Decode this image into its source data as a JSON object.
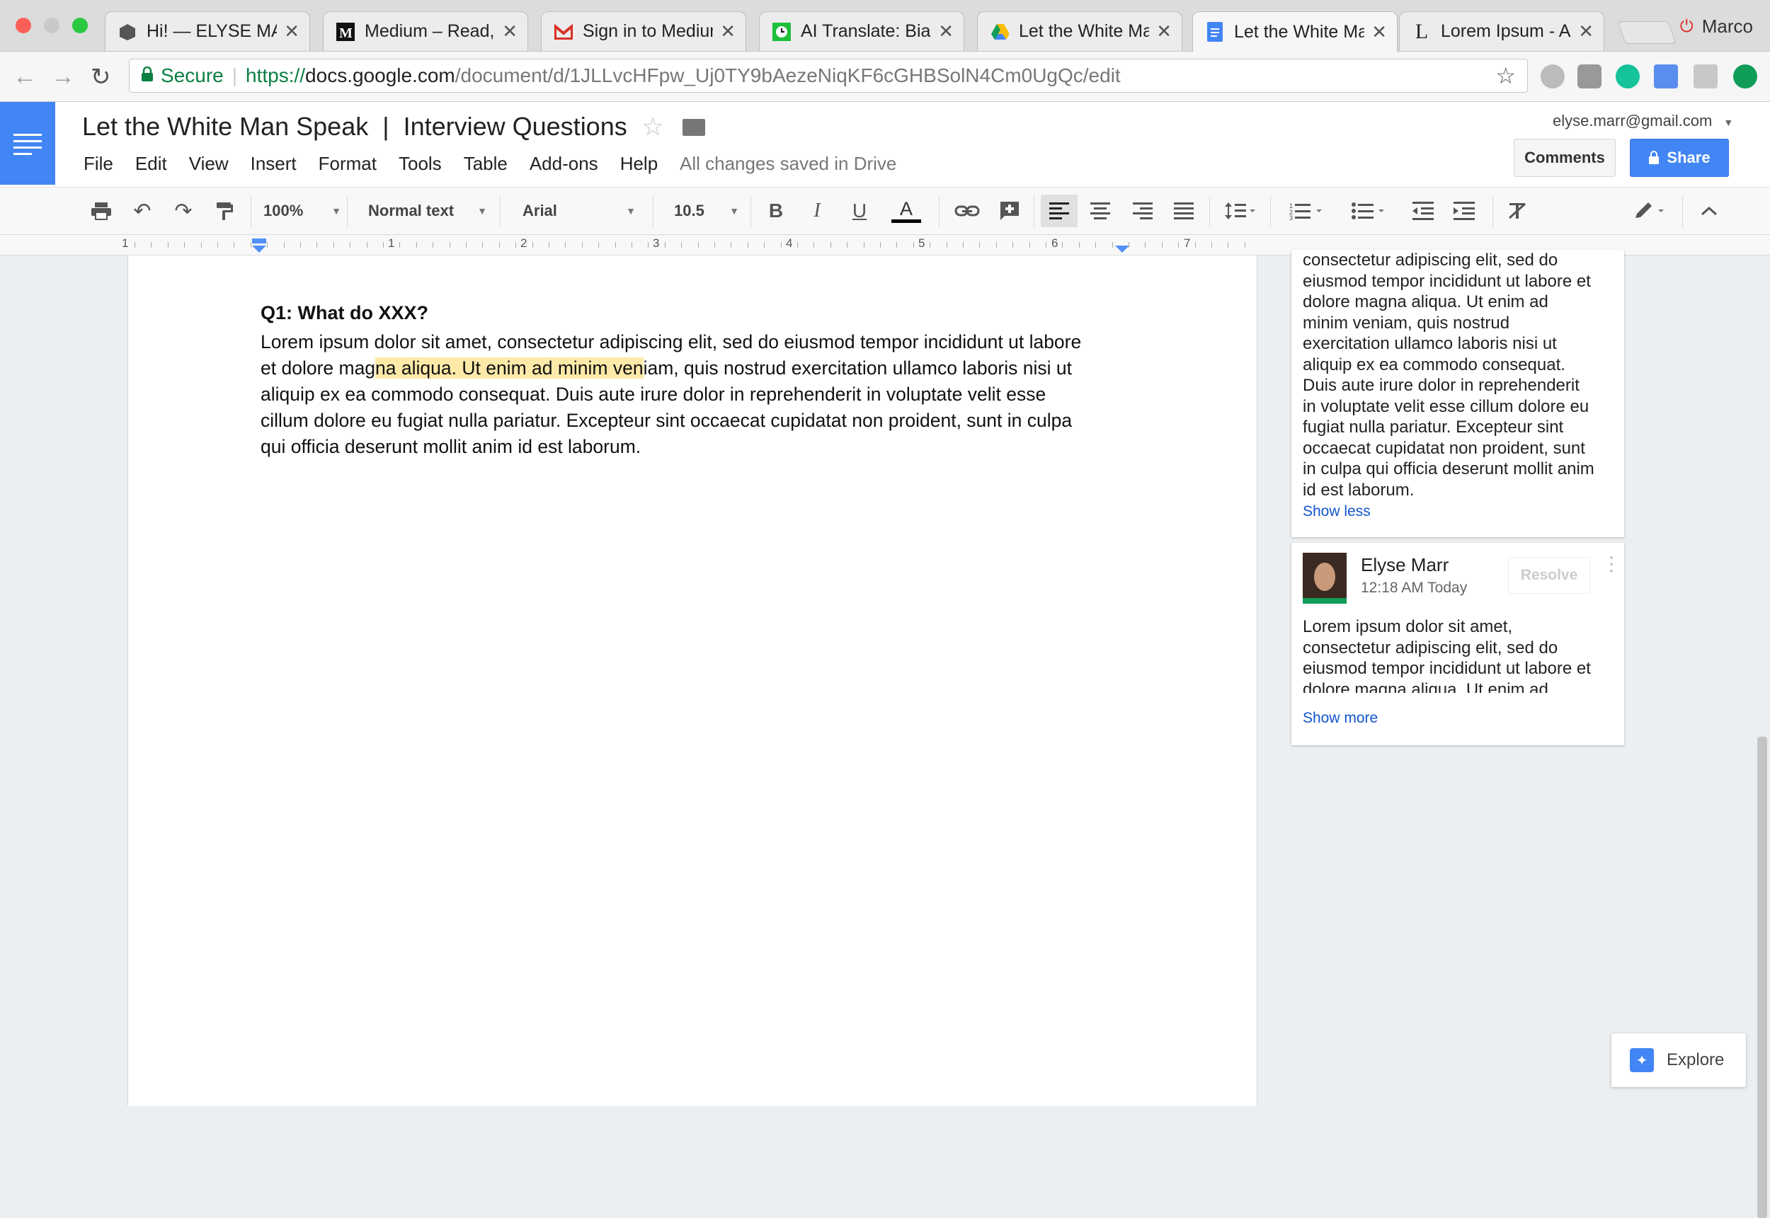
{
  "browser": {
    "tabs": [
      {
        "title": "Hi! — ELYSE MAR",
        "favicon": "cube-icon"
      },
      {
        "title": "Medium – Read, w",
        "favicon": "medium-icon"
      },
      {
        "title": "Sign in to Medium",
        "favicon": "gmail-icon"
      },
      {
        "title": "AI Translate: Bias",
        "favicon": "clock-icon"
      },
      {
        "title": "Let the White Mar",
        "favicon": "drive-icon"
      },
      {
        "title": "Let the White Mar",
        "favicon": "docs-icon",
        "active": true
      },
      {
        "title": "Lorem Ipsum - All",
        "favicon": "lorem-icon"
      }
    ],
    "profile_name": "Marco",
    "secure_label": "Secure",
    "url": {
      "scheme": "https://",
      "host": "docs.google.com",
      "path": "/document/d/1JLLvcHFpw_Uj0TY9bAezeNiqKF6cGHBSolN4Cm0UgQc/edit"
    }
  },
  "docs": {
    "title": "Let the White Man Speak  |  Interview Questions",
    "menu": [
      "File",
      "Edit",
      "View",
      "Insert",
      "Format",
      "Tools",
      "Table",
      "Add-ons",
      "Help"
    ],
    "save_status": "All changes saved in Drive",
    "account_email": "elyse.marr@gmail.com",
    "comments_button": "Comments",
    "share_button": "Share",
    "toolbar": {
      "zoom": "100%",
      "style": "Normal text",
      "font": "Arial",
      "font_size": "10.5",
      "bold": "B",
      "italic": "I",
      "underline": "U",
      "text_color": "A"
    },
    "ruler_numbers": [
      "1",
      "1",
      "2",
      "3",
      "4",
      "5",
      "6",
      "7"
    ]
  },
  "document": {
    "heading": "Q1: What do XXX?",
    "para_lines": [
      {
        "text": "Lorem ipsum dolor sit amet, consectetur adipiscing elit, sed do eiusmod tempor incididunt ut labore"
      },
      {
        "pre": "et dolore mag",
        "highlight": "na aliqua. Ut enim ad minim ven",
        "post": "iam, quis nostrud exercitation ullamco laboris nisi ut"
      },
      {
        "text": "aliquip ex ea commodo consequat. Duis aute irure dolor in reprehenderit in voluptate velit esse"
      },
      {
        "text": "cillum dolore eu fugiat nulla pariatur. Excepteur sint occaecat cupidatat non proident, sunt in culpa"
      },
      {
        "text": "qui officia deserunt mollit anim id est laborum."
      }
    ]
  },
  "comments": [
    {
      "lines": [
        "consectetur adipiscing elit, sed do",
        "eiusmod tempor incididunt ut labore et",
        "dolore magna aliqua. Ut enim ad",
        "minim veniam, quis nostrud",
        "exercitation ullamco laboris nisi ut",
        "aliquip ex ea commodo consequat.",
        "Duis aute irure dolor in reprehenderit",
        "in voluptate velit esse cillum dolore eu",
        "fugiat nulla pariatur. Excepteur sint",
        "occaecat cupidatat non proident, sunt",
        "in culpa qui officia deserunt mollit anim",
        "id est laborum."
      ],
      "toggle": "Show less"
    },
    {
      "author": "Elyse Marr",
      "time": "12:18 AM Today",
      "resolve": "Resolve",
      "lines": [
        "Lorem ipsum dolor sit amet,",
        "consectetur adipiscing elit, sed do",
        "eiusmod tempor incididunt ut labore et",
        "dolore magna aliqua. Ut enim ad"
      ],
      "toggle": "Show more"
    }
  ],
  "explore_label": "Explore"
}
